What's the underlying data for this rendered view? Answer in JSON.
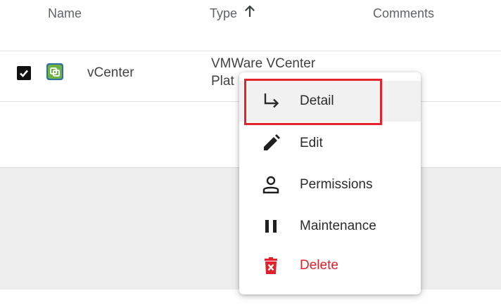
{
  "table": {
    "columns": [
      {
        "label": "Name"
      },
      {
        "label": "Type",
        "sort": "ascending"
      },
      {
        "label": "Comments"
      }
    ],
    "rows": [
      {
        "selected": true,
        "icon": "vcenter-app-icon",
        "name": "vCenter",
        "type_line1": "VMWare VCenter",
        "type_line2": "Plat"
      }
    ]
  },
  "context_menu": {
    "items": [
      {
        "label": "Detail",
        "icon": "subdirectory-arrow-icon",
        "highlighted": true
      },
      {
        "label": "Edit",
        "icon": "pencil-icon"
      },
      {
        "label": "Permissions",
        "icon": "person-icon"
      },
      {
        "label": "Maintenance",
        "icon": "pause-icon"
      },
      {
        "label": "Delete",
        "icon": "trash-x-icon",
        "color": "#e0212b"
      }
    ]
  },
  "colors": {
    "highlight_border": "#e3242b",
    "delete_red": "#e0212b",
    "empty_area": "#ededed"
  }
}
